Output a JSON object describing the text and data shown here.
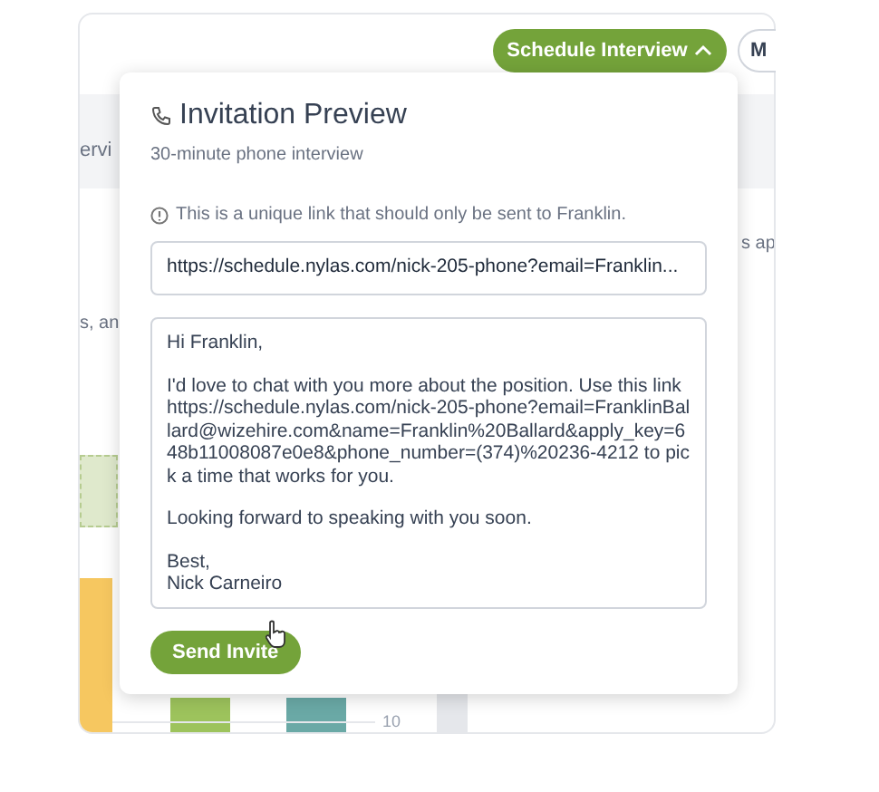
{
  "background": {
    "column_header": "ervi",
    "row_text": "s, an",
    "side_text": "s ap",
    "axis_tick": "10"
  },
  "schedule_button": {
    "label": "Schedule Interview",
    "expanded": true
  },
  "cut_button": {
    "label": "M"
  },
  "popup": {
    "title": "Invitation Preview",
    "subtitle": "30-minute phone interview",
    "notice": "This is a unique link that should only be sent to Franklin.",
    "link": "https://schedule.nylas.com/nick-205-phone?email=Franklin...",
    "message": [
      [
        "Hi Franklin,"
      ],
      [
        "I'd love to chat with you more about the position. Use this link https://schedule.nylas.com/nick-205-phone?email=FranklinBallard@wizehire.com&name=Franklin%20Ballard&apply_key=648b11008087e0e8&phone_number=(374)%20236-4212 to pick a time that works for you."
      ],
      [
        "Looking forward to speaking with you soon."
      ],
      [
        "Best,",
        "Nick Carneiro"
      ]
    ],
    "send_button": "Send Invite"
  }
}
